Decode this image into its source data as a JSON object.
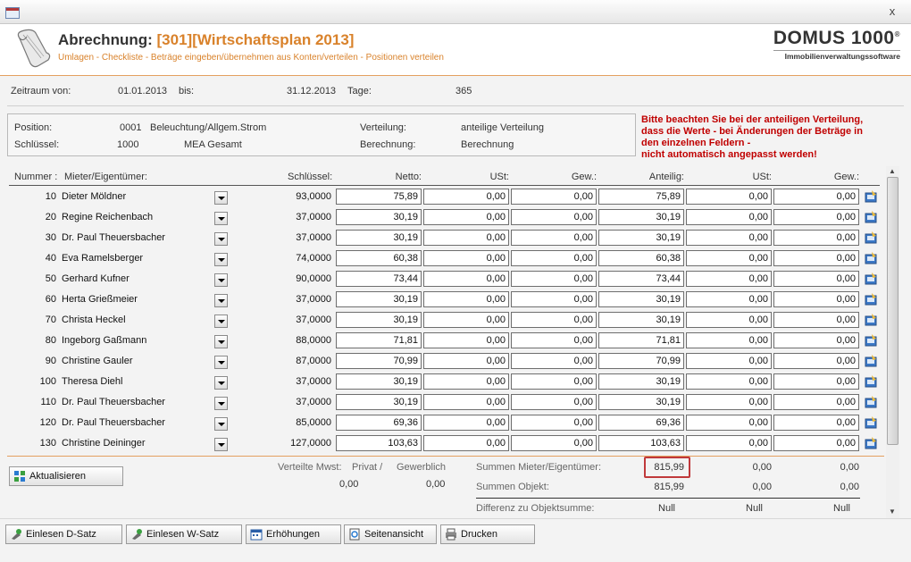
{
  "window": {
    "close_glyph": "x"
  },
  "header": {
    "title_prefix": "Abrechnung:",
    "title_highlight": "[301][Wirtschaftsplan 2013]",
    "subtitle": "Umlagen - Checkliste - Beträge eingeben/übernehmen aus Konten/verteilen - Positionen verteilen",
    "logo_brand": "DOMUS 1000",
    "logo_reg": "®",
    "logo_sub": "Immobilienverwaltungssoftware"
  },
  "period": {
    "from_label": "Zeitraum von:",
    "from_value": "01.01.2013",
    "to_label": "bis:",
    "to_value": "31.12.2013",
    "days_label": "Tage:",
    "days_value": "365"
  },
  "position": {
    "position_label": "Position:",
    "position_code": "0001",
    "position_name": "Beleuchtung/Allgem.Strom",
    "key_label": "Schlüssel:",
    "key_code": "1000",
    "key_name": "MEA Gesamt",
    "distribution_label": "Verteilung:",
    "distribution_value": "anteilige Verteilung",
    "calc_label": "Berechnung:",
    "calc_value": "Berechnung",
    "warning": [
      "Bitte beachten Sie bei der anteiligen Verteilung,",
      "dass die Werte - bei Änderungen der Beträge in",
      "den einzelnen Feldern -",
      "nicht automatisch angepasst werden!"
    ]
  },
  "columns": {
    "nummer": "Nummer :",
    "mieter": "Mieter/Eigentümer:",
    "schluessel": "Schlüssel:",
    "netto": "Netto:",
    "ust": "USt:",
    "gew": "Gew.:",
    "anteilig": "Anteilig:",
    "ust2": "USt:",
    "gew2": "Gew.:"
  },
  "rows": [
    {
      "nr": "10",
      "name": "Dieter Möldner",
      "key": "93,0000",
      "netto": "75,89",
      "ust": "0,00",
      "gew": "0,00",
      "anteilig": "75,89",
      "ust2": "0,00",
      "gew2": "0,00"
    },
    {
      "nr": "20",
      "name": "Regine Reichenbach",
      "key": "37,0000",
      "netto": "30,19",
      "ust": "0,00",
      "gew": "0,00",
      "anteilig": "30,19",
      "ust2": "0,00",
      "gew2": "0,00"
    },
    {
      "nr": "30",
      "name": "Dr. Paul Theuersbacher",
      "key": "37,0000",
      "netto": "30,19",
      "ust": "0,00",
      "gew": "0,00",
      "anteilig": "30,19",
      "ust2": "0,00",
      "gew2": "0,00"
    },
    {
      "nr": "40",
      "name": "Eva Ramelsberger",
      "key": "74,0000",
      "netto": "60,38",
      "ust": "0,00",
      "gew": "0,00",
      "anteilig": "60,38",
      "ust2": "0,00",
      "gew2": "0,00"
    },
    {
      "nr": "50",
      "name": "Gerhard Kufner",
      "key": "90,0000",
      "netto": "73,44",
      "ust": "0,00",
      "gew": "0,00",
      "anteilig": "73,44",
      "ust2": "0,00",
      "gew2": "0,00"
    },
    {
      "nr": "60",
      "name": "Herta Grießmeier",
      "key": "37,0000",
      "netto": "30,19",
      "ust": "0,00",
      "gew": "0,00",
      "anteilig": "30,19",
      "ust2": "0,00",
      "gew2": "0,00"
    },
    {
      "nr": "70",
      "name": "Christa Heckel",
      "key": "37,0000",
      "netto": "30,19",
      "ust": "0,00",
      "gew": "0,00",
      "anteilig": "30,19",
      "ust2": "0,00",
      "gew2": "0,00"
    },
    {
      "nr": "80",
      "name": "Ingeborg Gaßmann",
      "key": "88,0000",
      "netto": "71,81",
      "ust": "0,00",
      "gew": "0,00",
      "anteilig": "71,81",
      "ust2": "0,00",
      "gew2": "0,00"
    },
    {
      "nr": "90",
      "name": "Christine Gauler",
      "key": "87,0000",
      "netto": "70,99",
      "ust": "0,00",
      "gew": "0,00",
      "anteilig": "70,99",
      "ust2": "0,00",
      "gew2": "0,00"
    },
    {
      "nr": "100",
      "name": "Theresa Diehl",
      "key": "37,0000",
      "netto": "30,19",
      "ust": "0,00",
      "gew": "0,00",
      "anteilig": "30,19",
      "ust2": "0,00",
      "gew2": "0,00"
    },
    {
      "nr": "110",
      "name": "Dr. Paul Theuersbacher",
      "key": "37,0000",
      "netto": "30,19",
      "ust": "0,00",
      "gew": "0,00",
      "anteilig": "30,19",
      "ust2": "0,00",
      "gew2": "0,00"
    },
    {
      "nr": "120",
      "name": "Dr. Paul Theuersbacher",
      "key": "85,0000",
      "netto": "69,36",
      "ust": "0,00",
      "gew": "0,00",
      "anteilig": "69,36",
      "ust2": "0,00",
      "gew2": "0,00"
    },
    {
      "nr": "130",
      "name": "Christine Deininger",
      "key": "127,0000",
      "netto": "103,63",
      "ust": "0,00",
      "gew": "0,00",
      "anteilig": "103,63",
      "ust2": "0,00",
      "gew2": "0,00"
    }
  ],
  "footer": {
    "refresh_label": "Aktualisieren",
    "mwst_label": "Verteilte Mwst:",
    "privat_label": "Privat /",
    "gewerb_label": "Gewerblich",
    "privat_value": "0,00",
    "gewerb_value": "0,00",
    "sum_mieter_label": "Summen Mieter/Eigentümer:",
    "sum_mieter": [
      "815,99",
      "0,00",
      "0,00"
    ],
    "sum_objekt_label": "Summen Objekt:",
    "sum_objekt": [
      "815,99",
      "0,00",
      "0,00"
    ],
    "diff_label": "Differenz zu Objektsumme:",
    "diff": [
      "Null",
      "Null",
      "Null"
    ],
    "highlight_color": "#c0393b"
  },
  "buttons": [
    "Einlesen D-Satz",
    "Einlesen W-Satz",
    "Erhöhungen",
    "Seitenansicht",
    "Drucken"
  ],
  "colors": {
    "accent": "#d9822b",
    "warning": "#c00000"
  }
}
